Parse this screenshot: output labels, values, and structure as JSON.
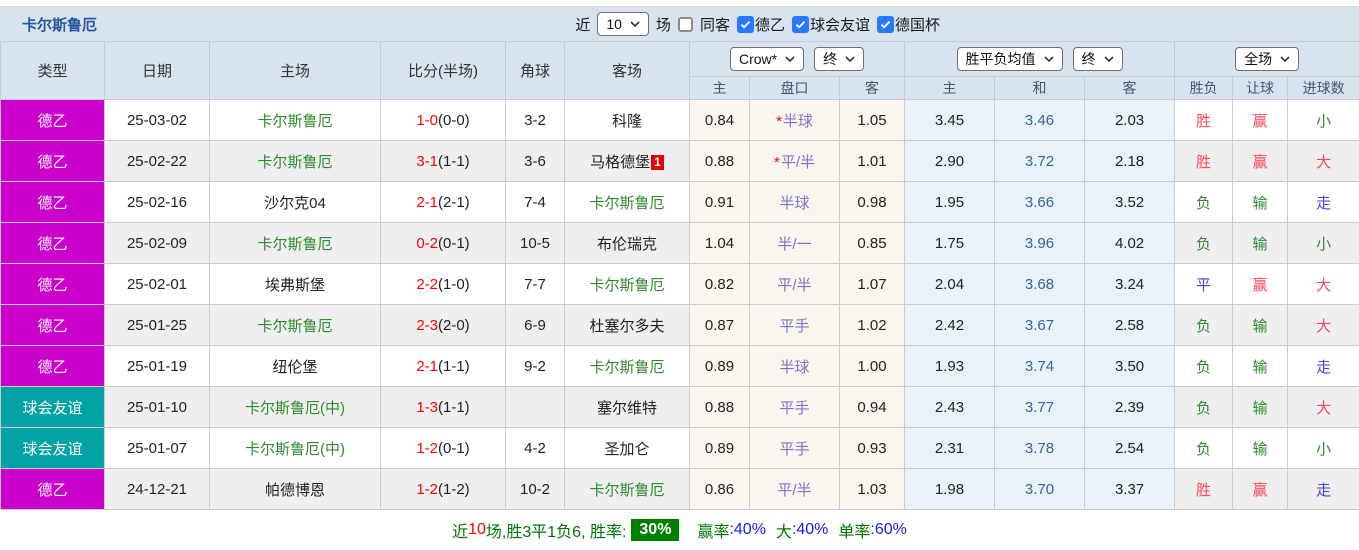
{
  "banner": {
    "team_title": "卡尔斯鲁厄",
    "near_label": "近",
    "near_count": "10",
    "games_label": "场",
    "same_away": {
      "label": "同客",
      "checked": false
    },
    "filters": [
      {
        "label": "德乙",
        "checked": true
      },
      {
        "label": "球会友谊",
        "checked": true
      },
      {
        "label": "德国杯",
        "checked": true
      }
    ]
  },
  "table": {
    "columns": [
      "类型",
      "日期",
      "主场",
      "比分(半场)",
      "角球",
      "客场"
    ],
    "dropdowns": {
      "bookmaker": "Crow*",
      "ah_time": "终",
      "europe_avg": "胜平负均值",
      "europe_time": "终",
      "scope": "全场"
    },
    "sub_headers": [
      "主",
      "盘口",
      "客",
      "主",
      "和",
      "客",
      "胜负",
      "让球",
      "进球数"
    ],
    "rows": [
      {
        "type": "德乙",
        "type_bg": "#cc00cc",
        "date": "25-03-02",
        "home": "卡尔斯鲁厄",
        "home_green": true,
        "score": "1-0",
        "half": "(0-0)",
        "corner": "3-2",
        "away": "科隆",
        "away_green": false,
        "away_badge": "",
        "ah_home": "0.84",
        "hcap_star": true,
        "handicap": "半球",
        "ah_away": "1.05",
        "eu_home": "3.45",
        "eu_draw": "3.46",
        "eu_away": "2.03",
        "wdl": "胜",
        "wdl_c": "red",
        "ah_res": "赢",
        "ah_c": "red",
        "ou": "小",
        "ou_c": "green"
      },
      {
        "type": "德乙",
        "type_bg": "#cc00cc",
        "date": "25-02-22",
        "home": "卡尔斯鲁厄",
        "home_green": true,
        "score": "3-1",
        "half": "(1-1)",
        "corner": "3-6",
        "away": "马格德堡",
        "away_green": false,
        "away_badge": "1",
        "ah_home": "0.88",
        "hcap_star": true,
        "handicap": "平/半",
        "ah_away": "1.01",
        "eu_home": "2.90",
        "eu_draw": "3.72",
        "eu_away": "2.18",
        "wdl": "胜",
        "wdl_c": "red",
        "ah_res": "赢",
        "ah_c": "red",
        "ou": "大",
        "ou_c": "red"
      },
      {
        "type": "德乙",
        "type_bg": "#cc00cc",
        "date": "25-02-16",
        "home": "沙尔克04",
        "home_green": false,
        "score": "2-1",
        "half": "(2-1)",
        "corner": "7-4",
        "away": "卡尔斯鲁厄",
        "away_green": true,
        "away_badge": "",
        "ah_home": "0.91",
        "hcap_star": false,
        "handicap": "半球",
        "ah_away": "0.98",
        "eu_home": "1.95",
        "eu_draw": "3.66",
        "eu_away": "3.52",
        "wdl": "负",
        "wdl_c": "green",
        "ah_res": "输",
        "ah_c": "green",
        "ou": "走",
        "ou_c": "blue"
      },
      {
        "type": "德乙",
        "type_bg": "#cc00cc",
        "date": "25-02-09",
        "home": "卡尔斯鲁厄",
        "home_green": true,
        "score": "0-2",
        "half": "(0-1)",
        "corner": "10-5",
        "away": "布伦瑞克",
        "away_green": false,
        "away_badge": "",
        "ah_home": "1.04",
        "hcap_star": false,
        "handicap": "半/一",
        "ah_away": "0.85",
        "eu_home": "1.75",
        "eu_draw": "3.96",
        "eu_away": "4.02",
        "wdl": "负",
        "wdl_c": "green",
        "ah_res": "输",
        "ah_c": "green",
        "ou": "小",
        "ou_c": "green"
      },
      {
        "type": "德乙",
        "type_bg": "#cc00cc",
        "date": "25-02-01",
        "home": "埃弗斯堡",
        "home_green": false,
        "score": "2-2",
        "half": "(1-0)",
        "corner": "7-7",
        "away": "卡尔斯鲁厄",
        "away_green": true,
        "away_badge": "",
        "ah_home": "0.82",
        "hcap_star": false,
        "handicap": "平/半",
        "ah_away": "1.07",
        "eu_home": "2.04",
        "eu_draw": "3.68",
        "eu_away": "3.24",
        "wdl": "平",
        "wdl_c": "blue",
        "ah_res": "赢",
        "ah_c": "red",
        "ou": "大",
        "ou_c": "red"
      },
      {
        "type": "德乙",
        "type_bg": "#cc00cc",
        "date": "25-01-25",
        "home": "卡尔斯鲁厄",
        "home_green": true,
        "score": "2-3",
        "half": "(2-0)",
        "corner": "6-9",
        "away": "杜塞尔多夫",
        "away_green": false,
        "away_badge": "",
        "ah_home": "0.87",
        "hcap_star": false,
        "handicap": "平手",
        "ah_away": "1.02",
        "eu_home": "2.42",
        "eu_draw": "3.67",
        "eu_away": "2.58",
        "wdl": "负",
        "wdl_c": "green",
        "ah_res": "输",
        "ah_c": "green",
        "ou": "大",
        "ou_c": "red"
      },
      {
        "type": "德乙",
        "type_bg": "#cc00cc",
        "date": "25-01-19",
        "home": "纽伦堡",
        "home_green": false,
        "score": "2-1",
        "half": "(1-1)",
        "corner": "9-2",
        "away": "卡尔斯鲁厄",
        "away_green": true,
        "away_badge": "",
        "ah_home": "0.89",
        "hcap_star": false,
        "handicap": "半球",
        "ah_away": "1.00",
        "eu_home": "1.93",
        "eu_draw": "3.74",
        "eu_away": "3.50",
        "wdl": "负",
        "wdl_c": "green",
        "ah_res": "输",
        "ah_c": "green",
        "ou": "走",
        "ou_c": "blue"
      },
      {
        "type": "球会友谊",
        "type_bg": "#00a3a3",
        "date": "25-01-10",
        "home": "卡尔斯鲁厄(中)",
        "home_green": true,
        "score": "1-3",
        "half": "(1-1)",
        "corner": "",
        "away": "塞尔维特",
        "away_green": false,
        "away_badge": "",
        "ah_home": "0.88",
        "hcap_star": false,
        "handicap": "平手",
        "ah_away": "0.94",
        "eu_home": "2.43",
        "eu_draw": "3.77",
        "eu_away": "2.39",
        "wdl": "负",
        "wdl_c": "green",
        "ah_res": "输",
        "ah_c": "green",
        "ou": "大",
        "ou_c": "red"
      },
      {
        "type": "球会友谊",
        "type_bg": "#00a3a3",
        "date": "25-01-07",
        "home": "卡尔斯鲁厄(中)",
        "home_green": true,
        "score": "1-2",
        "half": "(0-1)",
        "corner": "4-2",
        "away": "圣加仑",
        "away_green": false,
        "away_badge": "",
        "ah_home": "0.89",
        "hcap_star": false,
        "handicap": "平手",
        "ah_away": "0.93",
        "eu_home": "2.31",
        "eu_draw": "3.78",
        "eu_away": "2.54",
        "wdl": "负",
        "wdl_c": "green",
        "ah_res": "输",
        "ah_c": "green",
        "ou": "小",
        "ou_c": "green"
      },
      {
        "type": "德乙",
        "type_bg": "#cc00cc",
        "date": "24-12-21",
        "home": "帕德博恩",
        "home_green": false,
        "score": "1-2",
        "half": "(1-2)",
        "corner": "10-2",
        "away": "卡尔斯鲁厄",
        "away_green": true,
        "away_badge": "",
        "ah_home": "0.86",
        "hcap_star": false,
        "handicap": "平/半",
        "ah_away": "1.03",
        "eu_home": "1.98",
        "eu_draw": "3.70",
        "eu_away": "3.37",
        "wdl": "胜",
        "wdl_c": "red",
        "ah_res": "赢",
        "ah_c": "red",
        "ou": "走",
        "ou_c": "blue"
      }
    ]
  },
  "footer": {
    "near_label": "近",
    "near_count": "10",
    "summary": "场,胜3平1负6, 胜率:",
    "win_rate": "30%",
    "ah_label": "赢率",
    "ah_value": ":40%",
    "ou_label": "大",
    "ou_value": ":40%",
    "single_label": "单率",
    "single_value": ":60%"
  },
  "colors": {
    "league_type_bg": "#cc00cc",
    "friendly_type_bg": "#00a3a3",
    "team_highlight_green": "#2e8b2e",
    "score_red": "#ff0000",
    "result_red": "#ff4455",
    "result_green": "#2e8b2e",
    "result_blue": "#4444e0",
    "win_rate_badge_bg": "#008000",
    "banner_bg": "#d9e2ef"
  }
}
